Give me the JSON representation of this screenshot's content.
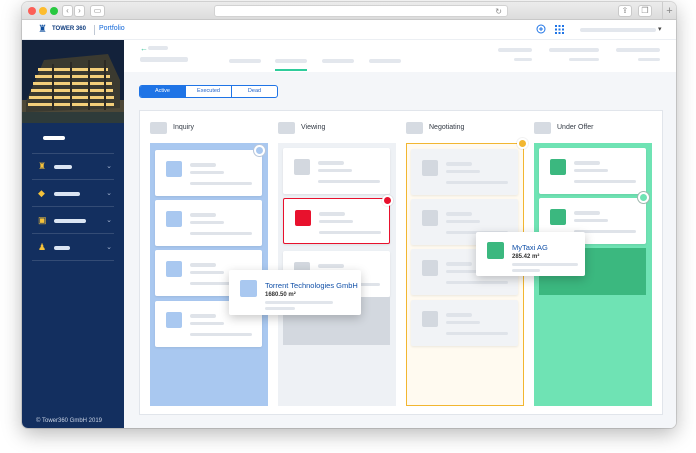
{
  "browser": {
    "reload_glyph": "↻"
  },
  "app": {
    "logo_text": "TOWER 360",
    "section": "Portfolio",
    "footer": "©  Tower360 GmbH 2019"
  },
  "sidebar": {
    "items": [
      {
        "icon": "building-icon",
        "glyph": "♜"
      },
      {
        "icon": "diamond-icon",
        "glyph": "◆"
      },
      {
        "icon": "floorplan-icon",
        "glyph": "▣"
      },
      {
        "icon": "people-icon",
        "glyph": "♟"
      }
    ]
  },
  "filters": {
    "tabs": [
      {
        "label": "Active",
        "selected": true
      },
      {
        "label": "Executed",
        "selected": false
      },
      {
        "label": "Dead",
        "selected": false
      }
    ]
  },
  "board": {
    "columns": [
      {
        "title": "Inquiry",
        "lane_color": "#a9c8f0"
      },
      {
        "title": "Viewing",
        "lane_color": "#e3e7ed"
      },
      {
        "title": "Negotiating",
        "lane_color": "#fffaf0",
        "border_color": "#f2b630"
      },
      {
        "title": "Under Offer",
        "lane_color": "#6fe3b4"
      }
    ],
    "popups": [
      {
        "name": "Torrent Technologies GmbH",
        "area": "1680.50 m²",
        "color": "#a9c8f0"
      },
      {
        "name": "MyTaxi AG",
        "area": "285.42 m²",
        "color": "#3bb87f"
      }
    ]
  },
  "colors": {
    "navy": "#132f5f",
    "primary": "#1f74e6",
    "alert_red": "#e8112d",
    "warning_amber": "#f2b630",
    "success_green": "#3bb87f"
  }
}
